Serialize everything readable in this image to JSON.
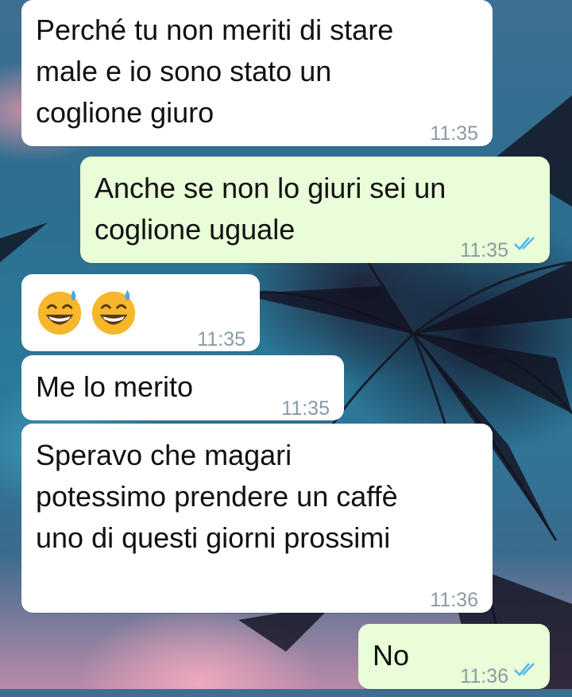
{
  "messages": [
    {
      "direction": "in",
      "lines": [
        "Perché tu non meriti di stare",
        "male e io sono stato un",
        "coglione giuro"
      ],
      "time": "11:35"
    },
    {
      "direction": "out",
      "lines": [
        "Anche se non lo giuri sei un",
        "coglione uguale"
      ],
      "time": "11:35",
      "status": "read"
    },
    {
      "direction": "in",
      "emoji": [
        "grinning-sweat-emoji",
        "grinning-sweat-emoji"
      ],
      "time": "11:35"
    },
    {
      "direction": "in",
      "lines": [
        "Me lo merito"
      ],
      "time": "11:35"
    },
    {
      "direction": "in",
      "lines": [
        "Speravo che magari",
        "potessimo prendere un caffè",
        "uno di questi giorni prossimi"
      ],
      "time": "11:36"
    },
    {
      "direction": "out",
      "lines": [
        "No"
      ],
      "time": "11:36",
      "status": "read"
    }
  ],
  "colors": {
    "incoming_bubble": "#ffffff",
    "outgoing_bubble": "#e8fdd8",
    "read_ticks": "#4fb6ec",
    "time_text": "#8a9aa3"
  }
}
